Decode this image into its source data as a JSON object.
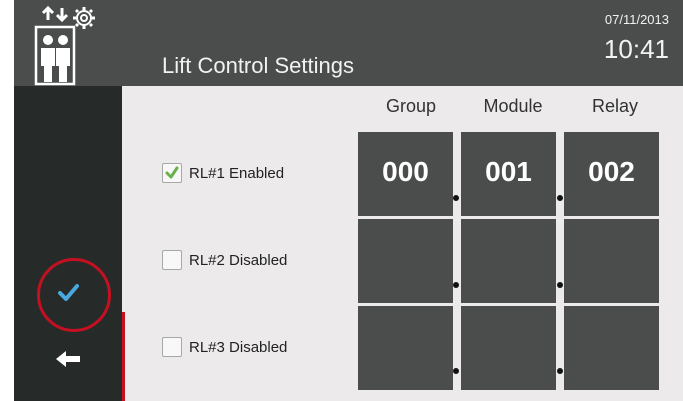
{
  "header": {
    "title": "Lift Control Settings",
    "date": "07/11/2013",
    "time": "10:41",
    "logo_icon": "lift-settings-icon"
  },
  "sidebar": {
    "confirm_icon": "checkmark-icon",
    "back_icon": "back-arrow-icon"
  },
  "columns": [
    "Group",
    "Module",
    "Relay"
  ],
  "rows": [
    {
      "label": "RL#1 Enabled",
      "checked": true,
      "values": [
        "000",
        "001",
        "002"
      ]
    },
    {
      "label": "RL#2 Disabled",
      "checked": false,
      "values": [
        "",
        "",
        ""
      ]
    },
    {
      "label": "RL#3 Disabled",
      "checked": false,
      "values": [
        "",
        "",
        ""
      ]
    }
  ],
  "colors": {
    "header_bg": "#4b4d4c",
    "sidebar_bg": "#262b29",
    "content_bg": "#eceaea",
    "cell_bg": "#4b4d4c",
    "accent_check": "#4aa8e0",
    "checkbox_check": "#6ab04c",
    "annotation": "#c41020"
  }
}
